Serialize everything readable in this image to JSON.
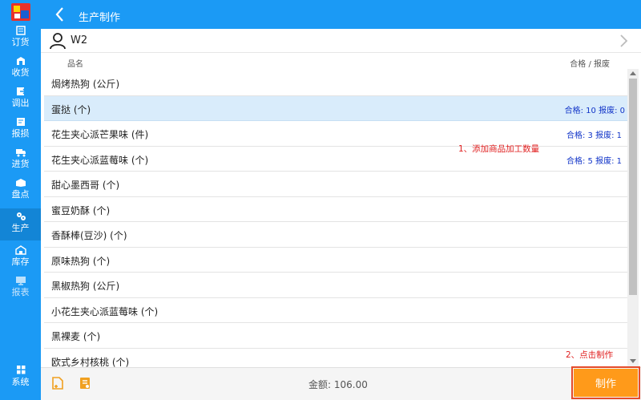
{
  "sidebar": {
    "items": [
      {
        "label": "订货",
        "icon": "order-icon"
      },
      {
        "label": "收货",
        "icon": "receive-icon"
      },
      {
        "label": "调出",
        "icon": "transfer-out-icon"
      },
      {
        "label": "报损",
        "icon": "loss-report-icon"
      },
      {
        "label": "进货",
        "icon": "truck-icon"
      },
      {
        "label": "盘点",
        "icon": "inventory-check-icon"
      },
      {
        "label": "生产",
        "icon": "gear-icon",
        "active": true
      },
      {
        "label": "库存",
        "icon": "warehouse-icon"
      },
      {
        "label": "报表",
        "icon": "report-icon",
        "dim": true
      },
      {
        "label": "系统",
        "icon": "grid-icon"
      }
    ]
  },
  "header": {
    "title": "生产制作"
  },
  "customer": {
    "name": "W2"
  },
  "columns": {
    "name": "品名",
    "status": "合格 / 报废"
  },
  "items": [
    {
      "name": "焗烤热狗 (公斤)",
      "status": ""
    },
    {
      "name": "蛋挞 (个)",
      "status": "合格: 10 报废: 0",
      "selected": true
    },
    {
      "name": "花生夹心派芒果味 (件)",
      "status": "合格: 3 报废: 1"
    },
    {
      "name": "花生夹心派蓝莓味 (个)",
      "status": "合格: 5 报废: 1"
    },
    {
      "name": "甜心墨西哥 (个)",
      "status": ""
    },
    {
      "name": "蜜豆奶酥 (个)",
      "status": ""
    },
    {
      "name": "香酥棒(豆沙) (个)",
      "status": ""
    },
    {
      "name": "原味热狗 (个)",
      "status": ""
    },
    {
      "name": "黑椒热狗 (公斤)",
      "status": ""
    },
    {
      "name": "小花生夹心派蓝莓味 (个)",
      "status": ""
    },
    {
      "name": "黑裸麦 (个)",
      "status": ""
    },
    {
      "name": "欧式乡村核桃 (个)",
      "status": ""
    }
  ],
  "annotations": {
    "step1": "1、添加商品加工数量",
    "step2": "2、点击制作"
  },
  "footer": {
    "amount": "金额: 106.00",
    "make_label": "制作"
  },
  "colors": {
    "primary": "#1b9af5",
    "accent": "#ff9a1a",
    "status_text": "#1235c8",
    "annotation": "#e02020",
    "selected_row": "#d9ecfb"
  }
}
